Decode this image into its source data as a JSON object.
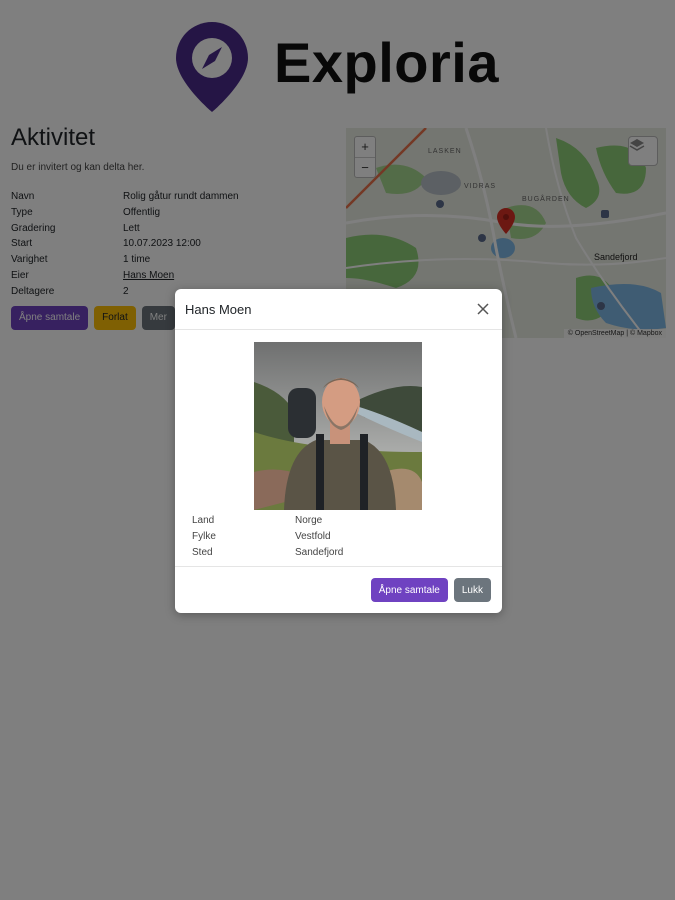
{
  "brand": {
    "name": "Exploria",
    "color": "#4b2a8a"
  },
  "activity": {
    "title": "Aktivitet",
    "subtitle": "Du er invitert og kan delta her.",
    "details": [
      {
        "label": "Navn",
        "value": "Rolig gåtur rundt dammen"
      },
      {
        "label": "Type",
        "value": "Offentlig"
      },
      {
        "label": "Gradering",
        "value": "Lett"
      },
      {
        "label": "Start",
        "value": "10.07.2023 12:00"
      },
      {
        "label": "Varighet",
        "value": "1 time"
      },
      {
        "label": "Eier",
        "value": "Hans Moen"
      },
      {
        "label": "Deltagere",
        "value": "2"
      }
    ],
    "buttons": {
      "open_chat": "Åpne samtale",
      "leave": "Forlat",
      "more": "Mer"
    }
  },
  "map": {
    "zoom_in": "+",
    "zoom_out": "−",
    "attribution": "© OpenStreetMap | © Mapbox",
    "labels": {
      "city": "Sandefjord",
      "area1": "BUGÅRDEN",
      "area2": "LASKEN",
      "area3": "VIDRAS"
    }
  },
  "modal": {
    "title": "Hans Moen",
    "info": [
      {
        "label": "Land",
        "value": "Norge"
      },
      {
        "label": "Fylke",
        "value": "Vestfold"
      },
      {
        "label": "Sted",
        "value": "Sandefjord"
      }
    ],
    "buttons": {
      "open_chat": "Åpne samtale",
      "close": "Lukk"
    }
  },
  "colors": {
    "purple": "#6f42c1",
    "yellow": "#ffc107",
    "gray": "#6c757d"
  }
}
